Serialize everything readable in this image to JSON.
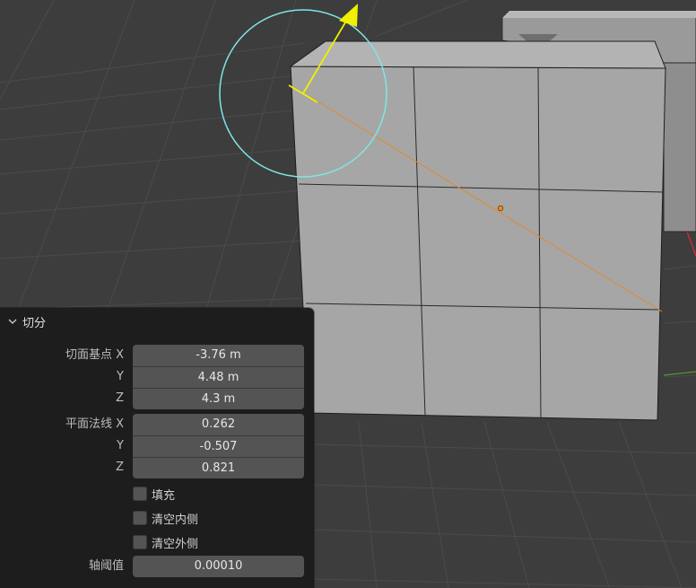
{
  "panel": {
    "title": "切分",
    "plane_point": {
      "label_x": "切面基点 X",
      "label_y": "Y",
      "label_z": "Z",
      "x": "-3.76 m",
      "y": "4.48 m",
      "z": "4.3 m"
    },
    "plane_normal": {
      "label_x": "平面法线 X",
      "label_y": "Y",
      "label_z": "Z",
      "x": "0.262",
      "y": "-0.507",
      "z": "0.821"
    },
    "fill": {
      "label": "填充",
      "checked": false
    },
    "clear_inner": {
      "label": "清空内侧",
      "checked": false
    },
    "clear_outer": {
      "label": "清空外侧",
      "checked": false
    },
    "axis_threshold": {
      "label": "轴阈值",
      "value": "0.00010"
    }
  },
  "viewport": {
    "colors": {
      "background": "#3d3d3d",
      "grid": "#4a4a4a",
      "mesh_face": "#a4a4a4",
      "gizmo_circle": "#7fe6e6",
      "gizmo_arrow": "#f0f000",
      "bisect_line": "#e08a2c"
    }
  }
}
